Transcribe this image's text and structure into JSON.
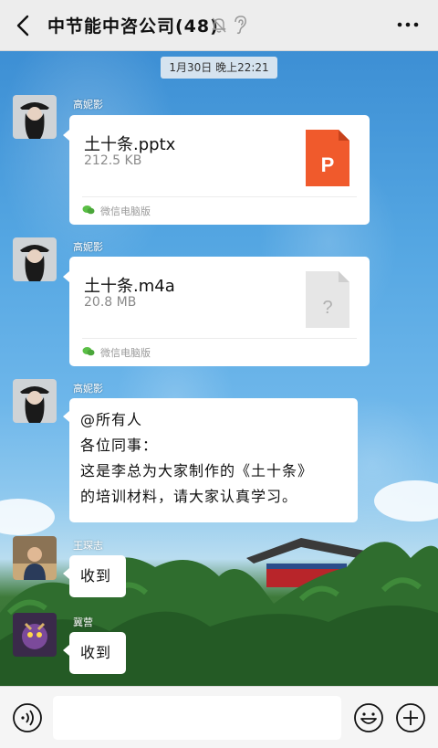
{
  "header": {
    "title": "中节能中咨公司(48)",
    "back_icon": "chevron-left-icon",
    "mute_icon": "bell-muted-icon",
    "ear_icon": "earpiece-icon",
    "more_icon": "more-dots-icon"
  },
  "chat": {
    "timestamp": "1月30日 晚上22:21",
    "messages": [
      {
        "sender": "高妮影",
        "type": "file",
        "file_name": "土十条.pptx",
        "file_size": "212.5 KB",
        "file_icon": "powerpoint-file-icon",
        "source": "微信电脑版"
      },
      {
        "sender": "高妮影",
        "type": "file",
        "file_name": "土十条.m4a",
        "file_size": "20.8 MB",
        "file_icon": "unknown-file-icon",
        "source": "微信电脑版"
      },
      {
        "sender": "高妮影",
        "type": "text",
        "text": "@所有人\n各位同事：\n这是李总为大家制作的《土十条》\n的培训材料，请大家认真学习。"
      },
      {
        "sender": "王琛志",
        "type": "text",
        "text": "收到"
      },
      {
        "sender": "冀营",
        "type": "text",
        "text": "收到"
      }
    ]
  },
  "inputbar": {
    "voice_icon": "voice-icon",
    "input_value": "",
    "emoji_icon": "emoji-icon",
    "plus_icon": "plus-icon"
  },
  "colors": {
    "header_bg": "#ededed",
    "ppt_orange": "#f05a2c",
    "chat_sky": "#54a6e2"
  }
}
